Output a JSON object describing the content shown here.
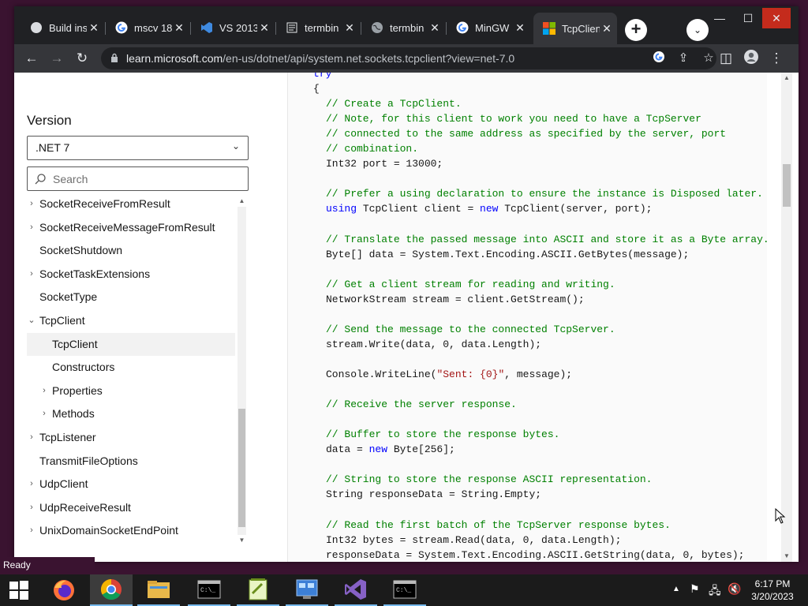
{
  "browser": {
    "tabs": [
      {
        "title": "Build ins",
        "icon": "gray-circle-icon"
      },
      {
        "title": "mscv 18",
        "icon": "google-icon"
      },
      {
        "title": "VS 2013",
        "icon": "vs-icon"
      },
      {
        "title": "termbin",
        "icon": "document-icon"
      },
      {
        "title": "termbin",
        "icon": "globe-icon"
      },
      {
        "title": "MinGW",
        "icon": "google-icon"
      },
      {
        "title": "TcpClien",
        "icon": "microsoft-icon"
      }
    ],
    "close_glyph": "✕",
    "new_tab": "+",
    "address": {
      "host": "learn.microsoft.com",
      "path": "/en-us/dotnet/api/system.net.sockets.tcpclient?view=net-7.0"
    }
  },
  "sidebar": {
    "version_heading": "Version",
    "version_value": ".NET 7",
    "search_placeholder": "Search",
    "toc": [
      {
        "label": "SocketReceiveFromResult",
        "expander": "›",
        "indent": 0
      },
      {
        "label": "SocketReceiveMessageFromResult",
        "expander": "›",
        "indent": 0
      },
      {
        "label": "SocketShutdown",
        "expander": "",
        "indent": 0
      },
      {
        "label": "SocketTaskExtensions",
        "expander": "›",
        "indent": 0
      },
      {
        "label": "SocketType",
        "expander": "",
        "indent": 0
      },
      {
        "label": "TcpClient",
        "expander": "⌄",
        "indent": 0
      },
      {
        "label": "TcpClient",
        "expander": "",
        "indent": 1,
        "selected": true
      },
      {
        "label": "Constructors",
        "expander": "",
        "indent": 1
      },
      {
        "label": "Properties",
        "expander": "›",
        "indent": 1
      },
      {
        "label": "Methods",
        "expander": "›",
        "indent": 1
      },
      {
        "label": "TcpListener",
        "expander": "›",
        "indent": 0
      },
      {
        "label": "TransmitFileOptions",
        "expander": "",
        "indent": 0
      },
      {
        "label": "UdpClient",
        "expander": "›",
        "indent": 0
      },
      {
        "label": "UdpReceiveResult",
        "expander": "›",
        "indent": 0
      },
      {
        "label": "UnixDomainSocketEndPoint",
        "expander": "›",
        "indent": 0
      }
    ]
  },
  "code_lines": [
    {
      "segments": [
        {
          "t": "try",
          "c": "kw"
        }
      ],
      "indent": 0,
      "clip": true
    },
    {
      "segments": [
        {
          "t": "{",
          "c": ""
        }
      ],
      "indent": 0
    },
    {
      "segments": [
        {
          "t": "// Create a TcpClient.",
          "c": "cm"
        }
      ],
      "indent": 1
    },
    {
      "segments": [
        {
          "t": "// Note, for this client to work you need to have a TcpServer",
          "c": "cm"
        }
      ],
      "indent": 1
    },
    {
      "segments": [
        {
          "t": "// connected to the same address as specified by the server, port",
          "c": "cm"
        }
      ],
      "indent": 1
    },
    {
      "segments": [
        {
          "t": "// combination.",
          "c": "cm"
        }
      ],
      "indent": 1
    },
    {
      "segments": [
        {
          "t": "Int32 port = 13000;",
          "c": ""
        }
      ],
      "indent": 1
    },
    {
      "segments": [],
      "indent": 1
    },
    {
      "segments": [
        {
          "t": "// Prefer a using declaration to ensure the instance is Disposed later.",
          "c": "cm"
        }
      ],
      "indent": 1
    },
    {
      "segments": [
        {
          "t": "using",
          "c": "kw"
        },
        {
          "t": " TcpClient client = ",
          "c": ""
        },
        {
          "t": "new",
          "c": "kw"
        },
        {
          "t": " TcpClient(server, port);",
          "c": ""
        }
      ],
      "indent": 1
    },
    {
      "segments": [],
      "indent": 1
    },
    {
      "segments": [
        {
          "t": "// Translate the passed message into ASCII and store it as a Byte array.",
          "c": "cm"
        }
      ],
      "indent": 1
    },
    {
      "segments": [
        {
          "t": "Byte[] data = System.Text.Encoding.ASCII.GetBytes(message);",
          "c": ""
        }
      ],
      "indent": 1
    },
    {
      "segments": [],
      "indent": 1
    },
    {
      "segments": [
        {
          "t": "// Get a client stream for reading and writing.",
          "c": "cm"
        }
      ],
      "indent": 1
    },
    {
      "segments": [
        {
          "t": "NetworkStream stream = client.GetStream();",
          "c": ""
        }
      ],
      "indent": 1
    },
    {
      "segments": [],
      "indent": 1
    },
    {
      "segments": [
        {
          "t": "// Send the message to the connected TcpServer.",
          "c": "cm"
        }
      ],
      "indent": 1
    },
    {
      "segments": [
        {
          "t": "stream.Write(data, 0, data.Length);",
          "c": ""
        }
      ],
      "indent": 1
    },
    {
      "segments": [],
      "indent": 1
    },
    {
      "segments": [
        {
          "t": "Console.WriteLine(",
          "c": ""
        },
        {
          "t": "\"Sent: {0}\"",
          "c": "st"
        },
        {
          "t": ", message);",
          "c": ""
        }
      ],
      "indent": 1
    },
    {
      "segments": [],
      "indent": 1
    },
    {
      "segments": [
        {
          "t": "// Receive the server response.",
          "c": "cm"
        }
      ],
      "indent": 1
    },
    {
      "segments": [],
      "indent": 1
    },
    {
      "segments": [
        {
          "t": "// Buffer to store the response bytes.",
          "c": "cm"
        }
      ],
      "indent": 1
    },
    {
      "segments": [
        {
          "t": "data = ",
          "c": ""
        },
        {
          "t": "new",
          "c": "kw"
        },
        {
          "t": " Byte[256];",
          "c": ""
        }
      ],
      "indent": 1
    },
    {
      "segments": [],
      "indent": 1
    },
    {
      "segments": [
        {
          "t": "// String to store the response ASCII representation.",
          "c": "cm"
        }
      ],
      "indent": 1
    },
    {
      "segments": [
        {
          "t": "String responseData = String.Empty;",
          "c": ""
        }
      ],
      "indent": 1
    },
    {
      "segments": [],
      "indent": 1
    },
    {
      "segments": [
        {
          "t": "// Read the first batch of the TcpServer response bytes.",
          "c": "cm"
        }
      ],
      "indent": 1
    },
    {
      "segments": [
        {
          "t": "Int32 bytes = stream.Read(data, 0, data.Length);",
          "c": ""
        }
      ],
      "indent": 1
    },
    {
      "segments": [
        {
          "t": "responseData = System.Text.Encoding.ASCII.GetString(data, 0, bytes);",
          "c": ""
        }
      ],
      "indent": 0
    }
  ],
  "status_text": "Ready",
  "taskbar": {
    "apps": [
      "start-button",
      "firefox",
      "chrome",
      "file-explorer",
      "terminal",
      "notepad-plus",
      "control-panel",
      "visual-studio",
      "terminal-2"
    ],
    "time": "6:17 PM",
    "date": "3/20/2023"
  },
  "colors": {
    "accent": "#0101fd",
    "comment": "#008000",
    "string": "#a31515"
  }
}
